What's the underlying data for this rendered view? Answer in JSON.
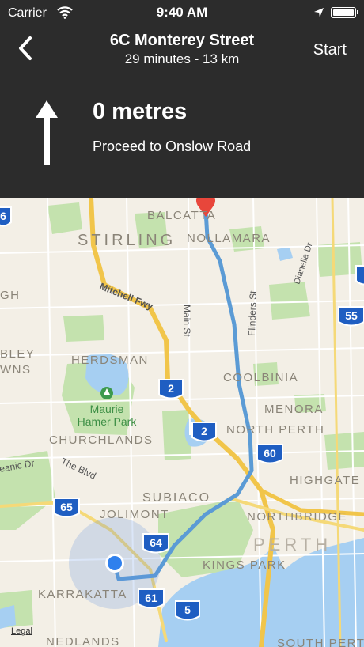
{
  "status_bar": {
    "carrier": "Carrier",
    "time": "9:40 AM"
  },
  "nav": {
    "title": "6C Monterey Street",
    "subtitle": "29 minutes - 13 km",
    "start_label": "Start"
  },
  "instruction": {
    "distance": "0 metres",
    "text": "Proceed to Onslow Road"
  },
  "map": {
    "suburbs": [
      "BALCATTA",
      "STIRLING",
      "NOLLAMARA",
      "HERDSMAN",
      "COOLBINIA",
      "MENORA",
      "CHURCHLANDS",
      "NORTH PERTH",
      "HIGHGATE",
      "SUBIACO",
      "NORTHBRIDGE",
      "JOLIMONT",
      "PERTH",
      "KINGS PARK",
      "KARRAKATTA",
      "NEDLANDS",
      "SOUTH PERTH",
      "GH",
      "BLEY",
      "WNS"
    ],
    "streets": [
      "Mitchell Fwy",
      "Main St",
      "Flinders St",
      "Dianella Dr",
      "The Blvd",
      "eanic Dr"
    ],
    "parks": [
      "Maurie",
      "Hamer Park"
    ],
    "shields": [
      "2",
      "2",
      "60",
      "55",
      "65",
      "64",
      "61",
      "5",
      "6"
    ],
    "legal": "Legal",
    "colors": {
      "route": "#5b9bd5",
      "freeway": "#f2c64b",
      "park": "#bfe0a8",
      "water": "#a4cdf0",
      "shield": "#1f5ec2",
      "pin": "#e8463b",
      "location": "#2f80ed"
    }
  }
}
